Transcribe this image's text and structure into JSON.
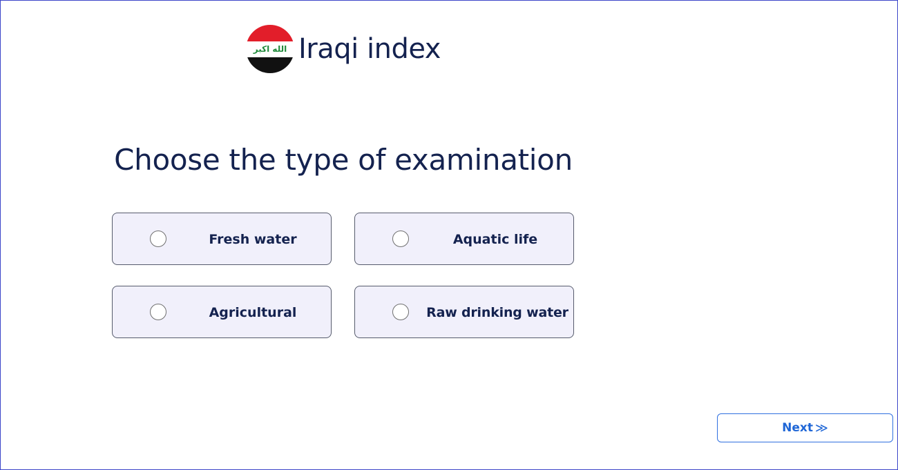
{
  "header": {
    "flag_icon": "iraq-flag-icon",
    "flag_text": "الله اكبر",
    "title": "Iraqi index"
  },
  "main": {
    "heading": "Choose the type of examination",
    "options": [
      {
        "label": "Fresh water",
        "selected": false
      },
      {
        "label": "Aquatic life",
        "selected": false
      },
      {
        "label": "Agricultural",
        "selected": false
      },
      {
        "label": "Raw drinking water",
        "selected": false
      }
    ]
  },
  "footer": {
    "next_label": "Next",
    "next_icon": "double-chevron-right-icon",
    "next_glyph": "≫"
  },
  "colors": {
    "title": "#14224f",
    "option_bg": "#f1f0fb",
    "accent": "#1f66d6",
    "frame": "#3b45c9"
  }
}
